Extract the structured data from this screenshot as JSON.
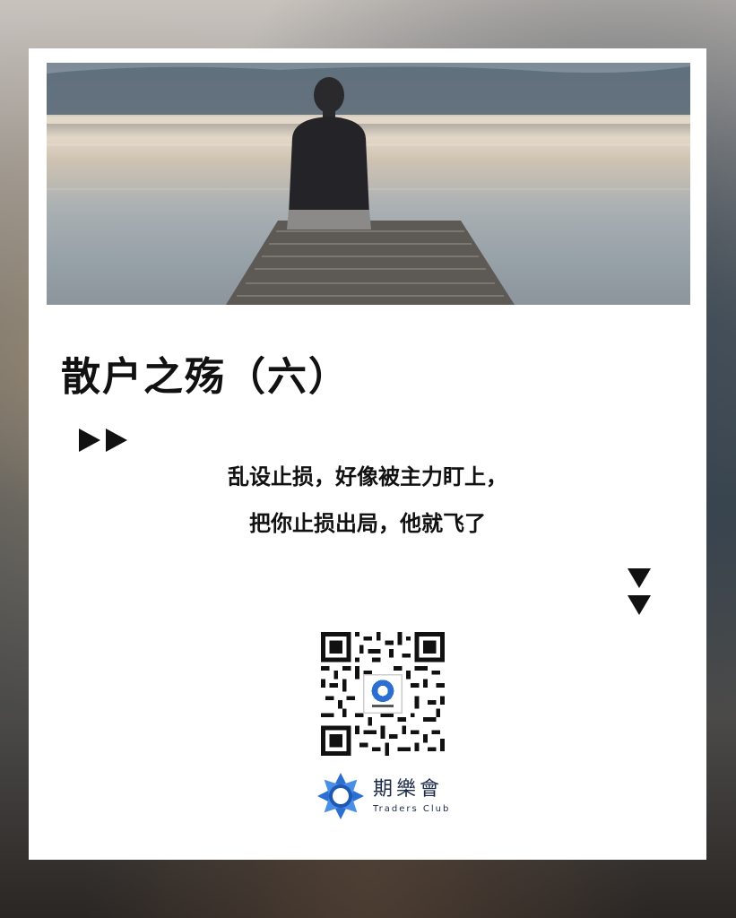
{
  "title": "散户之殇（六）",
  "lines": [
    "乱设止损，好像被主力盯上，",
    "把你止损出局，他就飞了"
  ],
  "icons": {
    "play": "play-icon",
    "down": "down-triangle-icon",
    "qr": "qr-code-icon",
    "logo": "traders-club-logo-icon"
  },
  "brand": {
    "name_cn": "期樂會",
    "name_en": "Traders Club"
  },
  "colors": {
    "accent": "#2a6fd1",
    "text": "#111111",
    "brand_text": "#1c2a4a"
  }
}
